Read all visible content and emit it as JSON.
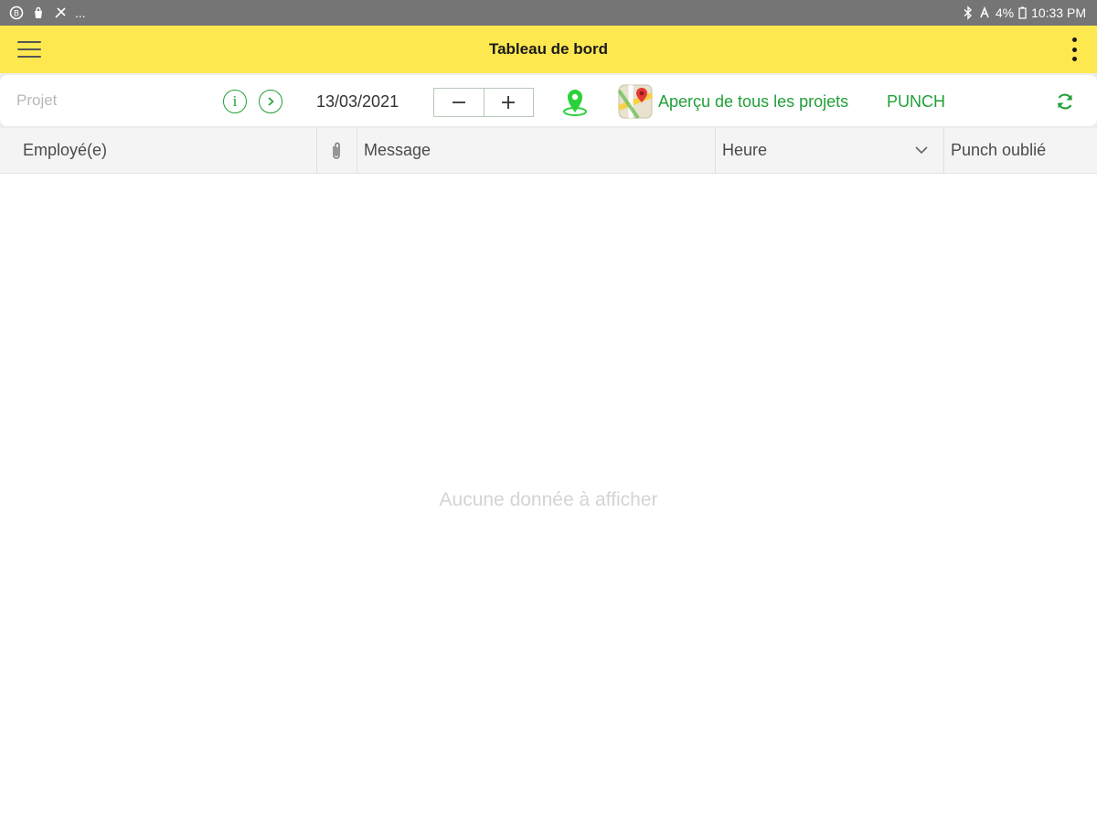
{
  "status_bar": {
    "battery": "4%",
    "time": "10:33 PM",
    "more": "..."
  },
  "app_bar": {
    "title": "Tableau de bord"
  },
  "toolbar": {
    "project_placeholder": "Projet",
    "project_value": "",
    "date": "13/03/2021",
    "overview_label": "Aperçu de tous les projets",
    "punch_label": "PUNCH",
    "accent_color": "#21a038"
  },
  "table": {
    "columns": {
      "employee": "Employé(e)",
      "message": "Message",
      "time": "Heure",
      "forgot": "Punch oublié"
    },
    "rows": [],
    "empty_message": "Aucune donnée à afficher"
  },
  "colors": {
    "app_bar": "#fde84f",
    "status_bar": "#757575",
    "accent": "#21a038"
  }
}
